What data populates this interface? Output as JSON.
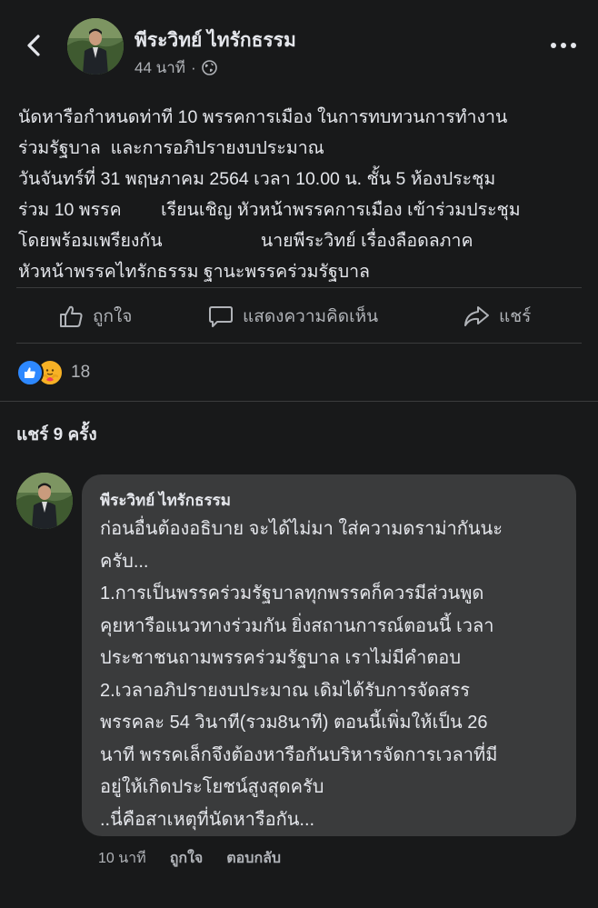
{
  "header": {
    "author_name": "พีระวิทย์ ไทรักธรรม",
    "timestamp": "44 นาที",
    "separator": "·",
    "audience_icon": "globe-icon"
  },
  "post": {
    "lines": [
      "นัดหารือกำหนดท่าที 10 พรรคการเมือง ในการทบทวนการทำงาน",
      "ร่วมรัฐบาล  และการอภิปรายงบประมาณ",
      "วันจันทร์ที่ 31 พฤษภาคม 2564 เวลา 10.00 น. ชั้น 5 ห้องประชุม",
      "ร่วม 10 พรรค        เรียนเชิญ หัวหน้าพรรคการเมือง เข้าร่วมประชุม",
      "โดยพร้อมเพรียงกัน                    นายพีระวิทย์ เรื่องลือดลภาค",
      "หัวหน้าพรรคไทรักธรรม ฐานะพรรคร่วมรัฐบาล"
    ]
  },
  "actions": {
    "like": "ถูกใจ",
    "comment": "แสดงความคิดเห็น",
    "share": "แชร์"
  },
  "reactions": {
    "count": "18",
    "icons": [
      "like-icon",
      "care-icon"
    ],
    "colors": {
      "like": "#2d88ff",
      "care": "#f7b125"
    }
  },
  "shares": {
    "label": "แชร์ 9 ครั้ง"
  },
  "comment": {
    "author": "พีระวิทย์ ไทรักธรรม",
    "lines": [
      "ก่อนอื่นต้องอธิบาย จะได้ไม่มา ใส่ความดราม่ากันนะ",
      "ครับ...",
      "1.การเป็นพรรคร่วมรัฐบาลทุกพรรคก็ควรมีส่วนพูด",
      "คุยหารือแนวทางร่วมกัน ยิ่งสถานการณ์ตอนนี้ เวลา",
      "ประชาชนถามพรรคร่วมรัฐบาล เราไม่มีคำตอบ",
      "2.เวลาอภิปรายงบประมาณ เดิมได้รับการจัดสรร",
      "พรรคละ 54 วินาที(รวม8นาที) ตอนนี้เพิ่มให้เป็น 26",
      "นาที พรรคเล็กจึงต้องหารือกันบริหารจัดการเวลาที่มี",
      "อยู่ให้เกิดประโยชน์สูงสุดครับ",
      "..นี่คือสาเหตุที่นัดหารือกัน..."
    ],
    "time": "10 นาที",
    "like": "ถูกใจ",
    "reply": "ตอบกลับ"
  },
  "theme": {
    "background": "#18191a",
    "bubble": "#3a3b3c",
    "text": "#e4e6eb",
    "secondary_text": "#b0b3b8"
  }
}
